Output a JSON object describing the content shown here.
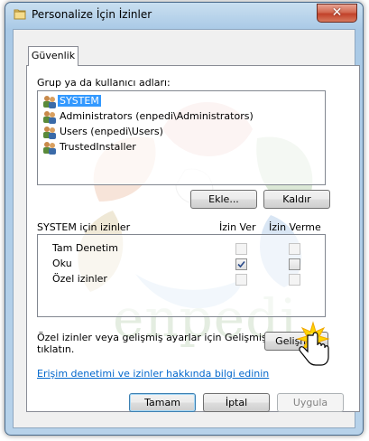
{
  "window": {
    "title": "Personalize İçin İzinler",
    "close_glyph": "✕"
  },
  "tabs": [
    {
      "label": "Güvenlik"
    }
  ],
  "users": {
    "label": "Grup ya da kullanıcı adları:",
    "items": [
      {
        "name": "SYSTEM",
        "selected": true
      },
      {
        "name": "Administrators (enpedi\\Administrators)",
        "selected": false
      },
      {
        "name": "Users (enpedi\\Users)",
        "selected": false
      },
      {
        "name": "TrustedInstaller",
        "selected": false
      }
    ],
    "add_label": "Ekle...",
    "remove_label": "Kaldır"
  },
  "permissions": {
    "header": "SYSTEM için izinler",
    "allow_header": "İzin Ver",
    "deny_header": "İzin Verme",
    "rows": [
      {
        "name": "Tam Denetim",
        "allow": false,
        "deny": false
      },
      {
        "name": "Oku",
        "allow": true,
        "deny": false
      },
      {
        "name": "Özel izinler",
        "allow": false,
        "deny": false
      }
    ]
  },
  "advanced": {
    "text_line1": "Özel izinler veya gelişmiş ayarlar için Gelişmiş'i",
    "text_line2": "tıklatın.",
    "button_label": "Gelişmiş"
  },
  "help_link": "Erişim denetimi ve izinler hakkında bilgi edinin",
  "footer": {
    "ok_label": "Tamam",
    "cancel_label": "İptal",
    "apply_label": "Uygula"
  },
  "watermark": {
    "text": "enpedi"
  }
}
